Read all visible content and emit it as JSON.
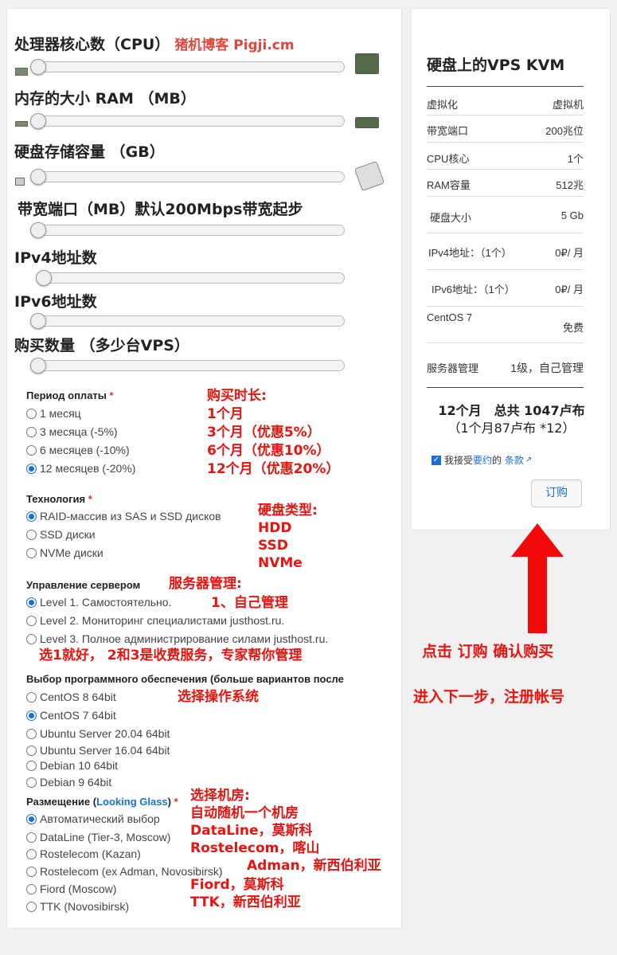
{
  "sliders": [
    {
      "label": "处理器核心数（CPU）",
      "brand": "猪机博客 Pigji.cm",
      "value": 0
    },
    {
      "label": "内存的大小 RAM （MB）",
      "value": 0
    },
    {
      "label": "硬盘存储容量 （GB）",
      "value": 0
    },
    {
      "label": "带宽端口（MB）默认200Mbps带宽起步",
      "value": 0
    },
    {
      "label": "IPv4地址数",
      "value": 0
    },
    {
      "label": "IPv6地址数",
      "value": 0
    },
    {
      "label": "购买数量 （多少台VPS）",
      "value": 0
    }
  ],
  "payment": {
    "title": "Период оплаты",
    "req": "*",
    "options": [
      "1 месяц",
      "3 месяца (-5%)",
      "6 месяцев (-10%)",
      "12 месяцев (-20%)"
    ],
    "selected": 3
  },
  "tech": {
    "title": "Технология",
    "req": "*",
    "options": [
      "RAID-массив из SAS и SSD дисков",
      "SSD диски",
      "NVMe диски"
    ],
    "selected": 0
  },
  "management": {
    "title": "Управление сервером",
    "options": [
      "Level 1. Самостоятельно.",
      "Level 2. Мониторинг специалистами justhost.ru.",
      "Level 3. Полное администрирование силами justhost.ru."
    ],
    "selected": 0
  },
  "software": {
    "title": "Выбор программного обеспечения (больше вариантов после",
    "options": [
      "CentOS 8 64bit",
      "CentOS 7 64bit",
      "Ubuntu Server 20.04 64bit",
      "Ubuntu Server 16.04 64bit",
      "Debian 10 64bit",
      "Debian 9 64bit"
    ],
    "selected": 1
  },
  "location": {
    "title": "Размещение (",
    "link": "Looking Glass",
    "title_end": ")",
    "req": "*",
    "options": [
      "Автоматический выбор",
      "DataLine (Tier-3, Moscow)",
      "Rostelecom (Kazan)",
      "Rostelecom (ex Adman, Novosibirsk)",
      "Fiord (Moscow)",
      "TTK (Novosibirsk)"
    ],
    "selected": 0
  },
  "annotations": {
    "period": [
      "购买时长:",
      "1个月",
      "3个月（优惠5%）",
      "6个月（优惠10%）",
      "12个月（优惠20%）"
    ],
    "disk": [
      "硬盘类型:",
      "HDD",
      "SSD",
      "NVMe"
    ],
    "mgmt_title": "服务器管理:",
    "mgmt_1": "1、自己管理",
    "mgmt_note": "选1就好， 2和3是收费服务，专家帮你管理",
    "os": "选择操作系统",
    "dc": [
      "选择机房:",
      "自动随机一个机房",
      "DataLine，莫斯科",
      "Rostelecom，喀山"
    ],
    "dc_adman": "Adman，新西伯利亚",
    "dc_rest": [
      "Fiord，莫斯科",
      "TTK，新西伯利亚"
    ],
    "click": "点击 订购 确认购买",
    "next": "进入下一步，注册帐号"
  },
  "summary": {
    "title": "硬盘上的VPS KVM",
    "rows": [
      {
        "label": "虚拟化",
        "value": "虚拟机"
      },
      {
        "label": "带宽端口",
        "value": "200兆位"
      },
      {
        "label": "CPU核心",
        "value": "1个"
      },
      {
        "label": "RAM容量",
        "value": "512兆"
      },
      {
        "label": "硬盘大小",
        "value": "5 Gb"
      },
      {
        "label": "IPv4地址：（1个）",
        "value": "0₽/ 月"
      },
      {
        "label": "IPv6地址：（1个）",
        "value": "0₽/ 月"
      },
      {
        "label": "CentOS 7",
        "value": "免费"
      },
      {
        "label": "服务器管理",
        "value": "1级，自己管理"
      }
    ],
    "total_line1": "12个月　总共 1047卢布",
    "total_line2": "（1个月87卢布 *12）",
    "agree_prefix": "我接受",
    "agree_link1": "要约",
    "agree_mid": "的",
    "agree_link2": "条款",
    "order_button": "订购"
  },
  "colors": {
    "accent": "#1a6fd6",
    "annotation": "#e8140f"
  }
}
